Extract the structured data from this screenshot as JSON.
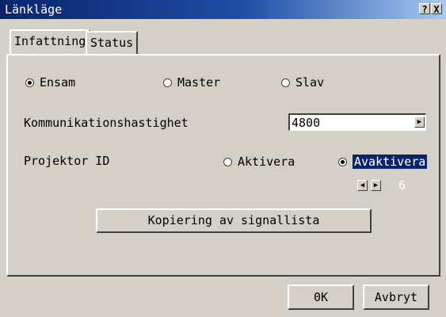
{
  "window": {
    "title": "Länkläge",
    "help_button": "?",
    "close_button": "X"
  },
  "tabs": [
    {
      "label": "Infattning"
    },
    {
      "label": "Status"
    }
  ],
  "mode": {
    "options": [
      {
        "label": "Ensam",
        "selected": true
      },
      {
        "label": "Master",
        "selected": false
      },
      {
        "label": "Slav",
        "selected": false
      }
    ]
  },
  "comm_speed": {
    "label": "Kommunikationshastighet",
    "value": "4800"
  },
  "projector_id": {
    "label": "Projektor ID",
    "options": [
      {
        "label": "Aktivera",
        "selected": false
      },
      {
        "label": "Avaktivera",
        "selected": true
      }
    ],
    "value": "6"
  },
  "copy_button": "Kopiering av signallista",
  "footer": {
    "ok": "0K",
    "cancel": "Avbryt"
  },
  "colors": {
    "title_bar": "#0a246a",
    "face": "#d4d0c8",
    "selection": "#0a246a"
  }
}
